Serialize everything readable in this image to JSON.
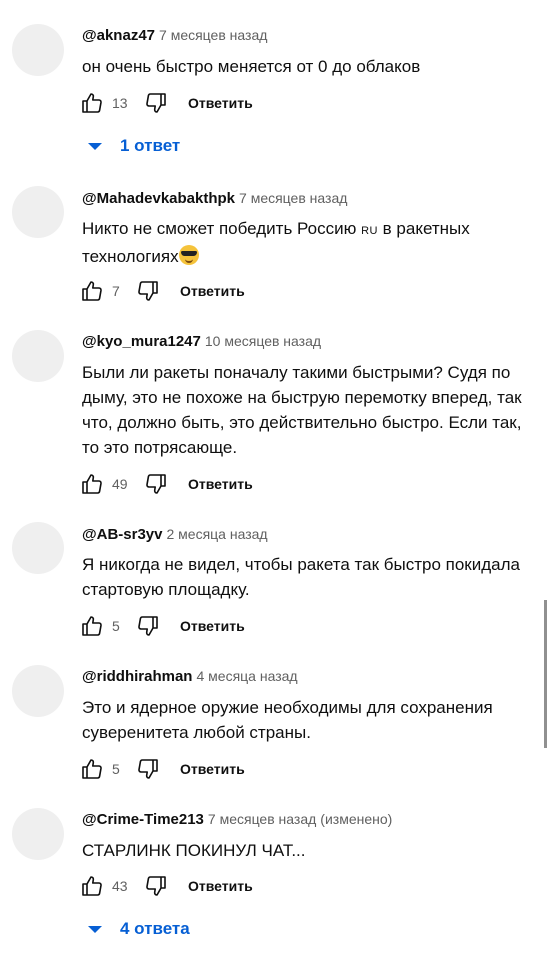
{
  "actions": {
    "reply_label": "Ответить"
  },
  "comments": [
    {
      "author": "@aknaz47",
      "time": "7 месяцев назад",
      "text": "он очень быстро меняется от 0 до облаков",
      "likes": "13",
      "replies": "1 ответ"
    },
    {
      "author": "@Mahadevkabakthpk",
      "time": "7 месяцев назад",
      "text_before": "Никто не сможет победить Россию ",
      "tag": "RU",
      "text_after": " в ракетных технологиях",
      "emoji": "smiling-face-with-sunglasses",
      "likes": "7"
    },
    {
      "author": "@kyo_mura1247",
      "time": "10 месяцев назад",
      "text": "Были ли ракеты поначалу такими быстрыми? Судя по дыму, это не похоже на быструю перемотку вперед, так что, должно быть, это действительно быстро. Если так, то это потрясающе.",
      "likes": "49"
    },
    {
      "author": "@AB-sr3yv",
      "time": "2 месяца назад",
      "text": "Я никогда не видел, чтобы ракета так быстро покидала стартовую площадку.",
      "likes": "5"
    },
    {
      "author": "@riddhirahman",
      "time": "4 месяца назад",
      "text": "Это и ядерное оружие необходимы для сохранения суверенитета любой страны.",
      "likes": "5"
    },
    {
      "author": "@Crime-Time213",
      "time": "7 месяцев назад",
      "edited": "(изменено)",
      "text": "СТАРЛИНК ПОКИНУЛ ЧАТ...",
      "likes": "43",
      "replies": "4 ответа"
    }
  ]
}
